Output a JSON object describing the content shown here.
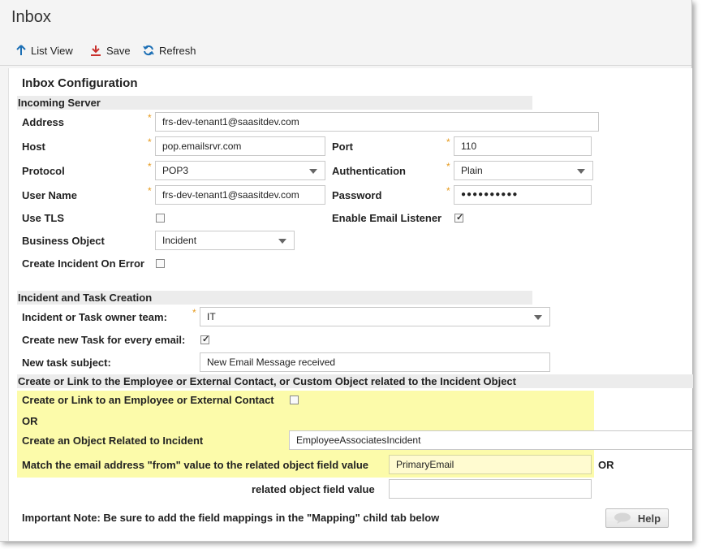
{
  "window": {
    "title": "Inbox"
  },
  "toolbar": {
    "list_view": "List View",
    "save": "Save",
    "refresh": "Refresh"
  },
  "config": {
    "title": "Inbox Configuration",
    "incoming_server_header": "Incoming Server",
    "address": {
      "label": "Address",
      "value": "frs-dev-tenant1@saasitdev.com"
    },
    "host": {
      "label": "Host",
      "value": "pop.emailsrvr.com"
    },
    "port": {
      "label": "Port",
      "value": "110"
    },
    "protocol": {
      "label": "Protocol",
      "value": "POP3"
    },
    "authentication": {
      "label": "Authentication",
      "value": "Plain"
    },
    "user_name": {
      "label": "User Name",
      "value": "frs-dev-tenant1@saasitdev.com"
    },
    "password": {
      "label": "Password",
      "value": "●●●●●●●●●●"
    },
    "use_tls": {
      "label": "Use TLS",
      "checked": false
    },
    "enable_listener": {
      "label": "Enable Email Listener",
      "checked": true
    },
    "business_object": {
      "label": "Business Object",
      "value": "Incident"
    },
    "create_incident_on_error": {
      "label": "Create Incident On Error",
      "checked": false
    },
    "incident_task_header": "Incident and Task Creation",
    "owner_team": {
      "label": "Incident or Task owner team:",
      "value": "IT"
    },
    "new_task": {
      "label": "Create new Task for every email:",
      "checked": true
    },
    "task_subject": {
      "label": "New task subject:",
      "value": "New Email Message received"
    },
    "link_header": "Create or Link to the Employee or External Contact, or Custom Object related to the Incident Object",
    "link_employee": {
      "label": "Create or Link to an Employee or External Contact",
      "checked": false
    },
    "or1": "OR",
    "related_object": {
      "label": "Create an Object Related to Incident",
      "value": "EmployeeAssociatesIncident"
    },
    "match_email": {
      "label": "Match the email address \"from\" value to the related object field value",
      "value": "PrimaryEmail",
      "or": "OR"
    },
    "related_field": {
      "label": "related object field value",
      "value": ""
    },
    "note": "Important Note: Be sure to add the field mappings in the \"Mapping\" child tab below",
    "help": "Help"
  }
}
